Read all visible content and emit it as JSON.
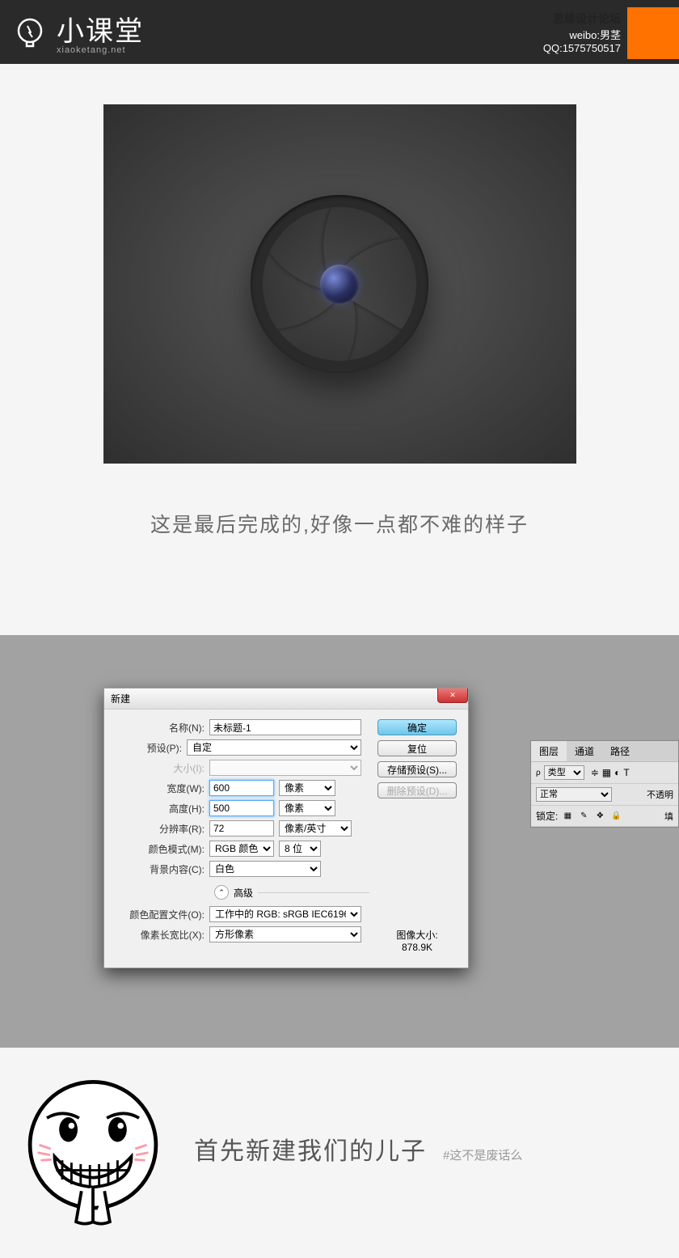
{
  "header": {
    "logo_main": "小课堂",
    "logo_sub": "xiaoketang.net",
    "forum": "思缘设计论坛",
    "weibo": "weibo:男茎",
    "qq": "QQ:1575750517"
  },
  "caption1": "这是最后完成的,好像一点都不难的样子",
  "dialog": {
    "title": "新建",
    "labels": {
      "name": "名称(N):",
      "preset": "预设(P):",
      "size": "大小(I):",
      "width": "宽度(W):",
      "height": "高度(H):",
      "resolution": "分辨率(R):",
      "color_mode": "颜色模式(M):",
      "bg": "背景内容(C):",
      "advanced": "高级",
      "profile": "颜色配置文件(O):",
      "aspect": "像素长宽比(X):"
    },
    "values": {
      "name": "未标题-1",
      "preset": "自定",
      "width": "600",
      "height": "500",
      "resolution": "72",
      "color_mode": "RGB 颜色",
      "bit": "8 位",
      "bg": "白色",
      "profile": "工作中的 RGB: sRGB IEC6196...",
      "aspect": "方形像素"
    },
    "units": {
      "px": "像素",
      "res": "像素/英寸"
    },
    "buttons": {
      "ok": "确定",
      "reset": "复位",
      "save_preset": "存储预设(S)...",
      "delete_preset": "删除预设(D)..."
    },
    "size_label": "图像大小:",
    "size_value": "878.9K"
  },
  "layers": {
    "tab1": "图层",
    "tab2": "通道",
    "tab3": "路径",
    "kind": "类型",
    "mode": "正常",
    "opacity": "不透明",
    "lock": "锁定:",
    "fill": "填"
  },
  "footer": {
    "main": "首先新建我们的儿子",
    "sub": "#这不是废话么"
  }
}
